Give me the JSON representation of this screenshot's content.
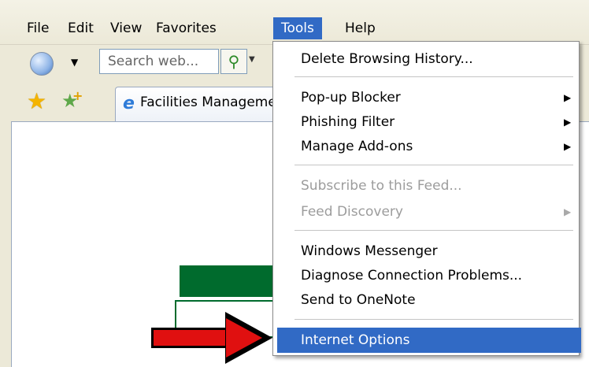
{
  "menubar": {
    "items": [
      {
        "label": "File"
      },
      {
        "label": "Edit"
      },
      {
        "label": "View"
      },
      {
        "label": "Favorites"
      },
      {
        "label": "Tools",
        "active": true
      },
      {
        "label": "Help"
      }
    ]
  },
  "toolbar": {
    "search_placeholder": "Search web..."
  },
  "tabs": [
    {
      "label": "Facilities Management"
    }
  ],
  "tools_menu": {
    "items": [
      {
        "label": "Delete Browsing History..."
      },
      {
        "label": "Pop-up Blocker",
        "submenu": true
      },
      {
        "label": "Phishing Filter",
        "submenu": true
      },
      {
        "label": "Manage Add-ons",
        "submenu": true
      },
      {
        "label": "Subscribe to this Feed...",
        "disabled": true
      },
      {
        "label": "Feed Discovery",
        "disabled": true,
        "submenu": true
      },
      {
        "label": "Windows Messenger"
      },
      {
        "label": "Diagnose Connection Problems..."
      },
      {
        "label": "Send to OneNote"
      },
      {
        "label": "Internet Options",
        "highlighted": true
      }
    ]
  },
  "colors": {
    "menu_highlight": "#316ac5",
    "arrow": "#e01010",
    "content_green": "#006b2d"
  },
  "icons": {
    "submenu_arrow": "▶",
    "dropdown_caret": "▼"
  }
}
